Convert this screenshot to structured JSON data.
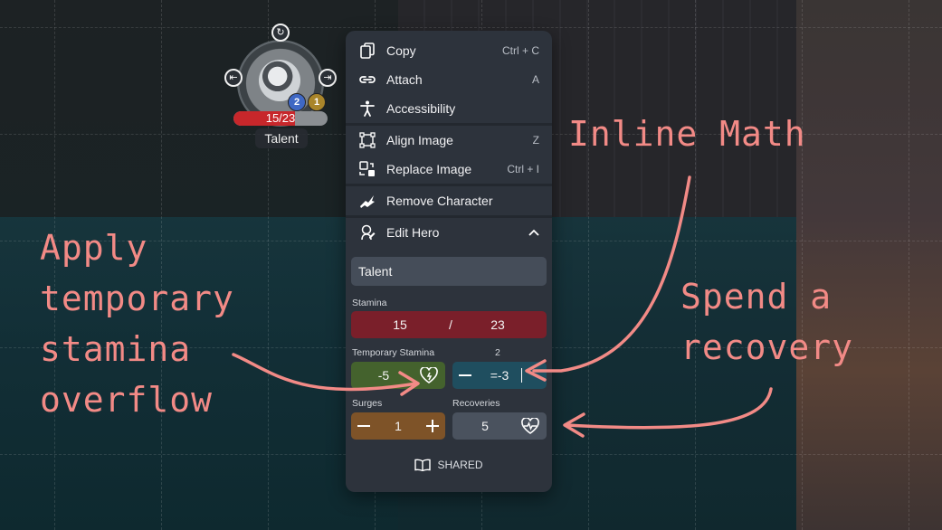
{
  "token": {
    "hp_current": 15,
    "hp_max": 23,
    "hp_label": "15/23",
    "name": "Talent",
    "badge_blue": "2",
    "badge_gold": "1",
    "icons": [
      "rotate-icon",
      "move-left-icon",
      "move-right-icon"
    ]
  },
  "menu": {
    "items": [
      {
        "label": "Copy",
        "shortcut": "Ctrl + C",
        "icon": "copy-icon"
      },
      {
        "label": "Attach",
        "shortcut": "A",
        "icon": "attach-icon"
      },
      {
        "label": "Accessibility",
        "shortcut": "",
        "icon": "accessibility-icon"
      },
      {
        "label": "Align Image",
        "shortcut": "Z",
        "icon": "align-icon"
      },
      {
        "label": "Replace Image",
        "shortcut": "Ctrl + I",
        "icon": "replace-icon"
      },
      {
        "label": "Remove Character",
        "shortcut": "",
        "icon": "remove-character-icon"
      },
      {
        "label": "Edit Hero",
        "shortcut": "",
        "icon": "edit-hero-icon"
      }
    ],
    "hero_name": "Talent",
    "stamina": {
      "label": "Stamina",
      "current": "15",
      "separator": "/",
      "max": "23"
    },
    "temp_stamina": {
      "label": "Temporary Stamina",
      "value": "-5"
    },
    "math": {
      "label": "2",
      "input": "=-3"
    },
    "surges": {
      "label": "Surges",
      "value": "1"
    },
    "recoveries": {
      "label": "Recoveries",
      "value": "5"
    },
    "shared_label": "SHARED"
  },
  "annotations": {
    "inline_math": "Inline Math",
    "apply_line1": "Apply",
    "apply_line2": "temporary",
    "apply_line3": "stamina",
    "apply_line4": "overflow",
    "spend_line1": "Spend a",
    "spend_line2": "recovery"
  },
  "colors": {
    "menu_bg": "#2d333c",
    "stamina_bg": "#7a1f2a",
    "temp_bg": "#44622d",
    "math_bg": "#1f4e5f",
    "surges_bg": "#7e5328",
    "annotation": "#f28a86"
  }
}
